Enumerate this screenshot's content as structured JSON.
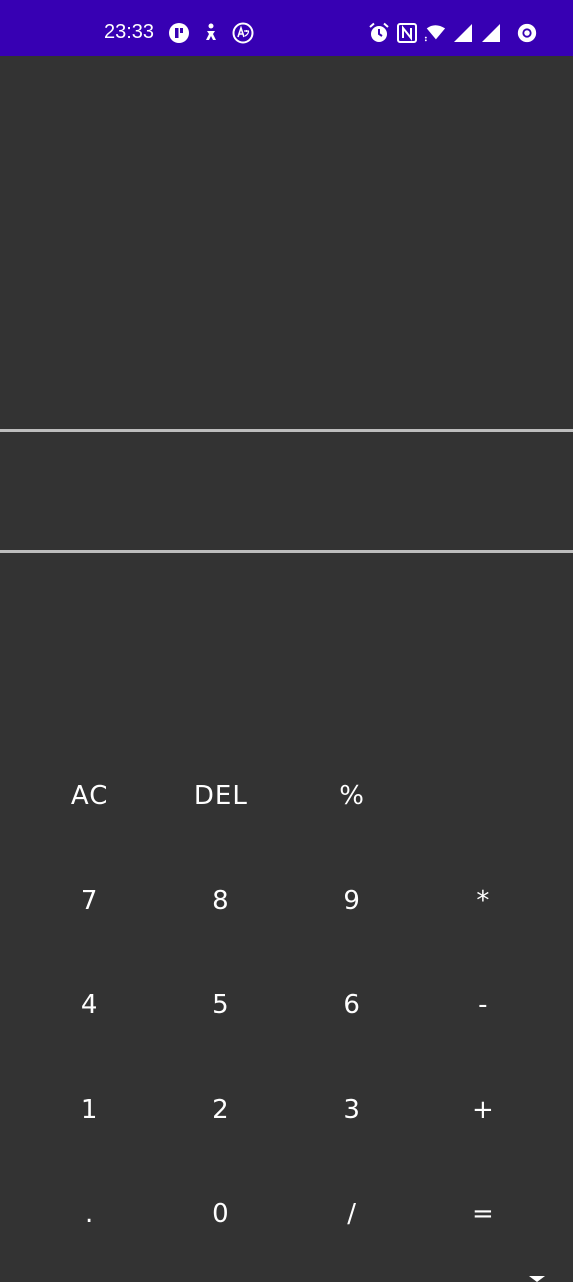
{
  "status_bar": {
    "time": "23:33",
    "background_color": "#3700b3",
    "left_icons": [
      "notification-app-icon",
      "accessibility-icon",
      "translate-icon"
    ],
    "right_icons": [
      "alarm-icon",
      "nfc-icon",
      "wifi-icon",
      "signal-icon",
      "signal-icon",
      "battery-icon"
    ]
  },
  "display": {
    "expression": "",
    "result": "",
    "background_color": "#333333",
    "divider_color": "#bdbdbd"
  },
  "keypad": {
    "rows": [
      [
        "AC",
        "DEL",
        "%",
        ""
      ],
      [
        "7",
        "8",
        "9",
        "*"
      ],
      [
        "4",
        "5",
        "6",
        "-"
      ],
      [
        "1",
        "2",
        "3",
        "+"
      ],
      [
        ".",
        "0",
        "/",
        "="
      ]
    ]
  }
}
